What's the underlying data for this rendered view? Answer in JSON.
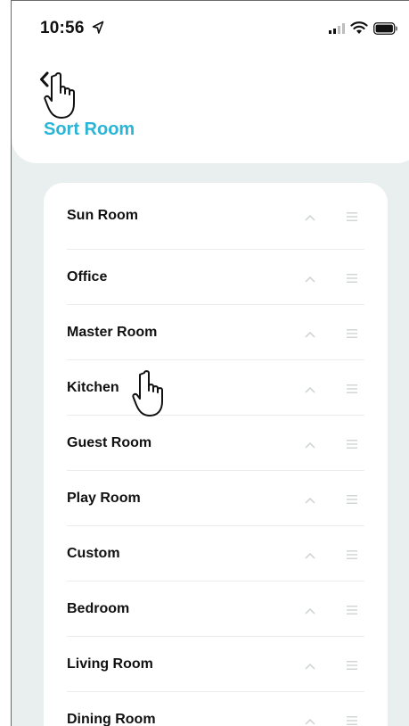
{
  "status_bar": {
    "time": "10:56"
  },
  "header": {
    "title": "Sort Room"
  },
  "rooms": [
    {
      "label": "Sun Room"
    },
    {
      "label": "Office"
    },
    {
      "label": "Master Room"
    },
    {
      "label": "Kitchen"
    },
    {
      "label": "Guest Room"
    },
    {
      "label": "Play Room"
    },
    {
      "label": "Custom"
    },
    {
      "label": "Bedroom"
    },
    {
      "label": "Living Room"
    },
    {
      "label": "Dining Room"
    }
  ],
  "colors": {
    "accent": "#2ab5d7",
    "background": "#e9eeee",
    "card": "#ffffff",
    "icon_muted": "#d2d6d6"
  },
  "icons": {
    "status": [
      "location-arrow-icon",
      "cellular-signal-icon",
      "wifi-icon",
      "battery-icon"
    ],
    "nav": "chevron-left-icon",
    "row_actions": [
      "chevron-up-icon",
      "drag-handle-icon"
    ],
    "overlay": "hand-pointer-cursor-icon"
  }
}
